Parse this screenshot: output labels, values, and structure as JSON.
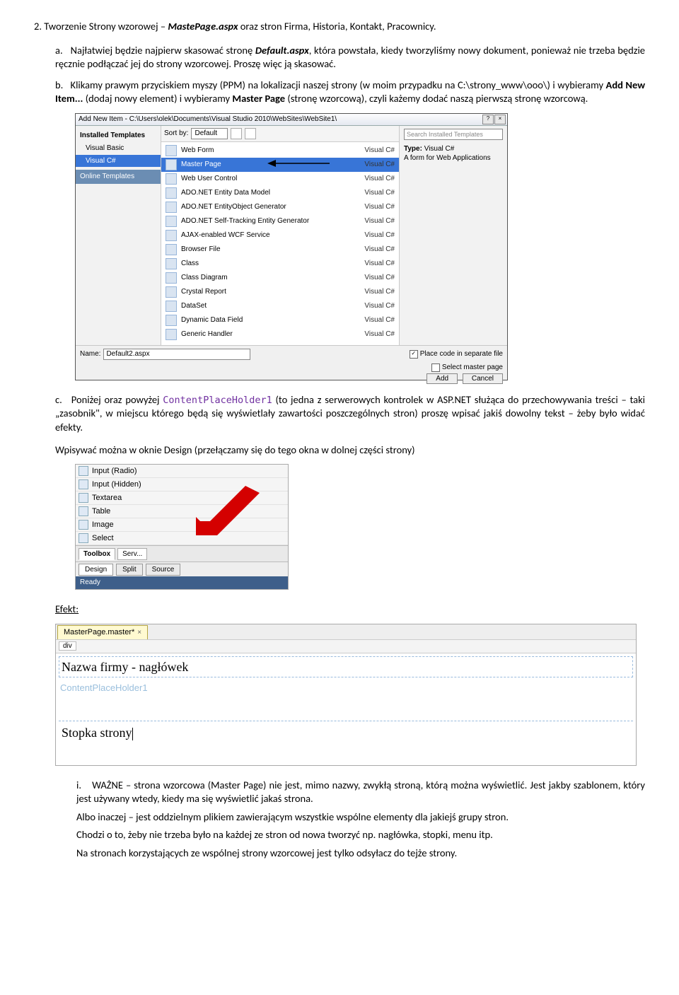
{
  "section": {
    "num": "2.",
    "title_pre": "Tworzenie Strony wzorowej – ",
    "title_ital": "MastePage.aspx",
    "title_post": " oraz stron Firma, Historia, Kontakt, Pracownicy."
  },
  "a": {
    "letter": "a.",
    "p1_pre": "Najłatwiej będzie najpierw skasować stronę ",
    "p1_b": "Default.aspx",
    "p1_post": ", która powstała, kiedy tworzyliśmy nowy dokument, ponieważ nie trzeba będzie ręcznie podłączać jej do strony wzorcowej. Proszę więc ją skasować."
  },
  "b": {
    "letter": "b.",
    "p_pre": "Klikamy prawym przyciskiem myszy (PPM) na lokalizacji naszej strony (w moim przypadku na C:\\strony_www\\ooo\\) i wybieramy ",
    "b1": "Add New Item...",
    "mid": " (dodaj nowy element) i wybieramy ",
    "b2": "Master Page",
    "post": " (stronę wzorcową), czyli każemy dodać naszą pierwszą stronę wzorcową."
  },
  "dlg": {
    "title": "Add New Item - C:\\Users\\olek\\Documents\\Visual Studio 2010\\WebSites\\WebSite1\\",
    "installed": "Installed Templates",
    "left_items": [
      "Visual Basic",
      "Visual C#"
    ],
    "online": "Online Templates",
    "sortby": "Sort by:",
    "sort_default": "Default",
    "templates": [
      "Web Form",
      "Master Page",
      "Web User Control",
      "ADO.NET Entity Data Model",
      "ADO.NET EntityObject Generator",
      "ADO.NET Self-Tracking Entity Generator",
      "AJAX-enabled WCF Service",
      "Browser File",
      "Class",
      "Class Diagram",
      "Crystal Report",
      "DataSet",
      "Dynamic Data Field",
      "Generic Handler"
    ],
    "langcol": "Visual C#",
    "search_ph": "Search Installed Templates",
    "type_lbl": "Type:",
    "type_val": "Visual C#",
    "type_desc": "A form for Web Applications",
    "name_lbl": "Name:",
    "name_val": "Default2.aspx",
    "chk1": "Place code in separate file",
    "chk2": "Select master page",
    "btn_add": "Add",
    "btn_cancel": "Cancel"
  },
  "c": {
    "letter": "c.",
    "p1_pre": "Poniżej oraz powyżej ",
    "p1_code": "ContentPlaceHolder1",
    "p1_mid": "  (to jedna z serwerowych kontrolek w ASP.NET służąca do przechowywania treści – taki „zasobnik\", w miejscu którego będą się wyświetlały zawartości poszczególnych stron) proszę wpisać jakiś dowolny tekst – żeby było widać efekty.",
    "p2": "Wpisywać można w oknie Design (przełączamy się do tego okna w dolnej części strony)"
  },
  "toolbox": {
    "items": [
      "Input (Radio)",
      "Input (Hidden)",
      "Textarea",
      "Table",
      "Image",
      "Select"
    ],
    "tabs": [
      "Toolbox",
      "Serv..."
    ],
    "views": [
      "Design",
      "Split",
      "Source"
    ],
    "ready": "Ready"
  },
  "efekt": "Efekt:",
  "editor": {
    "tab": "MasterPage.master*",
    "crumb": "div",
    "header_text": "Nazwa firmy - nagłówek",
    "cph": "ContentPlaceHolder1",
    "footer_text": "Stopka strony"
  },
  "i": {
    "roman": "i.",
    "p1": "WAŻNE – strona wzorcowa (Master Page) nie jest, mimo nazwy, zwykłą stroną, którą można wyświetlić. Jest jakby szablonem, który jest używany wtedy, kiedy ma się wyświetlić jakaś strona.",
    "p2": "Albo inaczej – jest oddzielnym plikiem zawierającym wszystkie wspólne elementy dla jakiejś grupy stron.",
    "p3": "Chodzi o to, żeby nie trzeba było na każdej ze stron od nowa tworzyć np. nagłówka, stopki, menu itp.",
    "p4": "Na stronach korzystających ze wspólnej strony wzorcowej jest tylko odsyłacz do tejże strony."
  }
}
